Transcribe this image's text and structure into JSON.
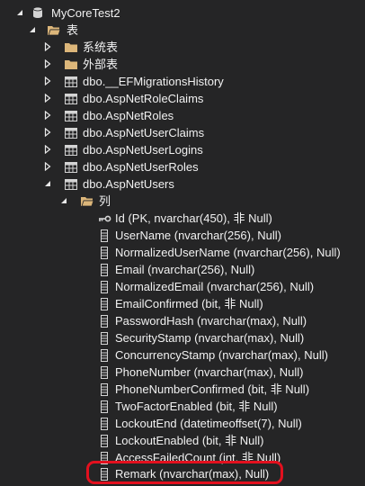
{
  "tree": {
    "database": "MyCoreTest2",
    "tables_folder": "表",
    "system_tables": "系统表",
    "external_tables": "外部表",
    "tables": [
      "dbo.__EFMigrationsHistory",
      "dbo.AspNetRoleClaims",
      "dbo.AspNetRoles",
      "dbo.AspNetUserClaims",
      "dbo.AspNetUserLogins",
      "dbo.AspNetUserRoles",
      "dbo.AspNetUsers"
    ],
    "columns_folder": "列",
    "columns": [
      "Id (PK, nvarchar(450), 非 Null)",
      "UserName (nvarchar(256), Null)",
      "NormalizedUserName (nvarchar(256), Null)",
      "Email (nvarchar(256), Null)",
      "NormalizedEmail (nvarchar(256), Null)",
      "EmailConfirmed (bit, 非 Null)",
      "PasswordHash (nvarchar(max), Null)",
      "SecurityStamp (nvarchar(max), Null)",
      "ConcurrencyStamp (nvarchar(max), Null)",
      "PhoneNumber (nvarchar(max), Null)",
      "PhoneNumberConfirmed (bit, 非 Null)",
      "TwoFactorEnabled (bit, 非 Null)",
      "LockoutEnd (datetimeoffset(7), Null)",
      "LockoutEnabled (bit, 非 Null)",
      "AccessFailedCount (int, 非 Null)",
      "Remark (nvarchar(max), Null)"
    ]
  },
  "colors": {
    "background": "#252526",
    "text": "#f1f1f1",
    "folder": "#dcb67a",
    "highlight": "#e3101e"
  },
  "icons": {
    "database": "database-icon",
    "folder": "folder-icon",
    "table": "table-icon",
    "primary_key": "key-icon",
    "column": "column-icon",
    "expanded": "triangle-down-icon",
    "collapsed": "triangle-right-icon"
  }
}
